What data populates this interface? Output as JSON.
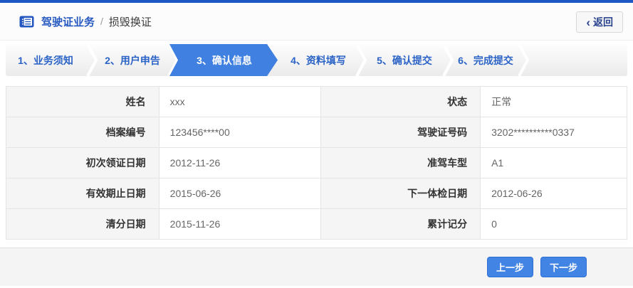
{
  "header": {
    "title": "驾驶证业务",
    "divider": "/",
    "subtitle": "损毁换证",
    "back_button": {
      "chevron": "‹",
      "label": "返回"
    }
  },
  "steps": [
    {
      "label": "1、业务须知",
      "active": false
    },
    {
      "label": "2、用户申告",
      "active": false
    },
    {
      "label": "3、确认信息",
      "active": true
    },
    {
      "label": "4、资料填写",
      "active": false
    },
    {
      "label": "5、确认提交",
      "active": false
    },
    {
      "label": "6、完成提交",
      "active": false
    }
  ],
  "info_table": {
    "rows": [
      [
        {
          "label": "姓名",
          "value": "xxx"
        },
        {
          "label": "状态",
          "value": "正常"
        }
      ],
      [
        {
          "label": "档案编号",
          "value": "123456****00"
        },
        {
          "label": "驾驶证号码",
          "value": "3202**********0337"
        }
      ],
      [
        {
          "label": "初次领证日期",
          "value": "2012-11-26"
        },
        {
          "label": "准驾车型",
          "value": "A1"
        }
      ],
      [
        {
          "label": "有效期止日期",
          "value": "2015-06-26"
        },
        {
          "label": "下一体检日期",
          "value": "2012-06-26"
        }
      ],
      [
        {
          "label": "清分日期",
          "value": "2015-11-26"
        },
        {
          "label": "累计记分",
          "value": "0"
        }
      ]
    ]
  },
  "footer": {
    "prev_label": "上一步",
    "next_label": "下一步"
  },
  "colors": {
    "topbar_blue": "#1e56c4",
    "accent_blue": "#2b63c6",
    "active_step_blue": "#3f80e0",
    "button_blue": "#4284e4",
    "label_bg": "#f5f5f5",
    "footer_bg": "#f4f4f4"
  }
}
